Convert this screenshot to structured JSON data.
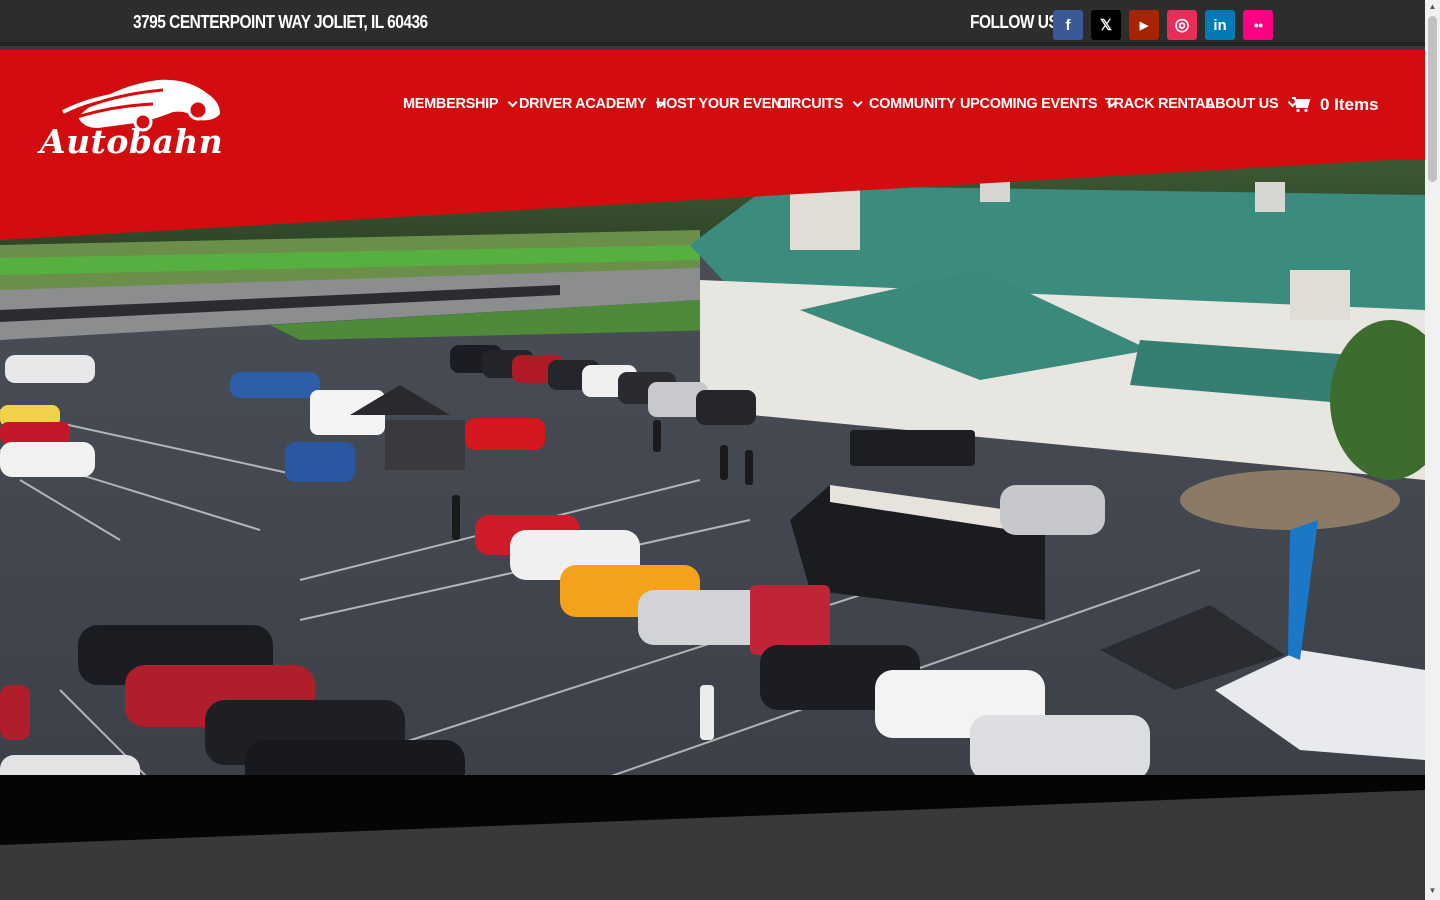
{
  "topbar": {
    "address": "3795 CENTERPOINT WAY JOLIET, IL 60436",
    "follow_label": "FOLLOW US:",
    "socials": [
      {
        "name": "facebook",
        "glyph": "f",
        "color": "#3b5998"
      },
      {
        "name": "x",
        "glyph": "𝕏",
        "color": "#000000"
      },
      {
        "name": "youtube",
        "glyph": "▶",
        "color": "#a82400"
      },
      {
        "name": "instagram",
        "glyph": "◎",
        "color": "#ea2c59"
      },
      {
        "name": "linkedin",
        "glyph": "in",
        "color": "#007bb6"
      },
      {
        "name": "flickr",
        "glyph": "●●",
        "color": "#ff0084"
      }
    ]
  },
  "header": {
    "logo_text": "Autobahn",
    "nav": [
      {
        "label": "MEMBERSHIP",
        "has_dropdown": true
      },
      {
        "label": "DRIVER ACADEMY",
        "has_dropdown": true
      },
      {
        "label": "HOST YOUR EVENT",
        "has_dropdown": false
      },
      {
        "label": "CIRCUITS",
        "has_dropdown": true
      },
      {
        "label": "COMMUNITY",
        "has_dropdown": false
      },
      {
        "label": "UPCOMING EVENTS",
        "has_dropdown": true
      },
      {
        "label": "TRACK RENTAL",
        "has_dropdown": false
      },
      {
        "label": "ABOUT US",
        "has_dropdown": true
      }
    ],
    "cart_label": "0 Items",
    "cart_icon": "shopping-cart-icon"
  },
  "colors": {
    "header_red": "#d30c0f",
    "topbar": "#2e2d2e",
    "dark_band": "#3a3839"
  }
}
